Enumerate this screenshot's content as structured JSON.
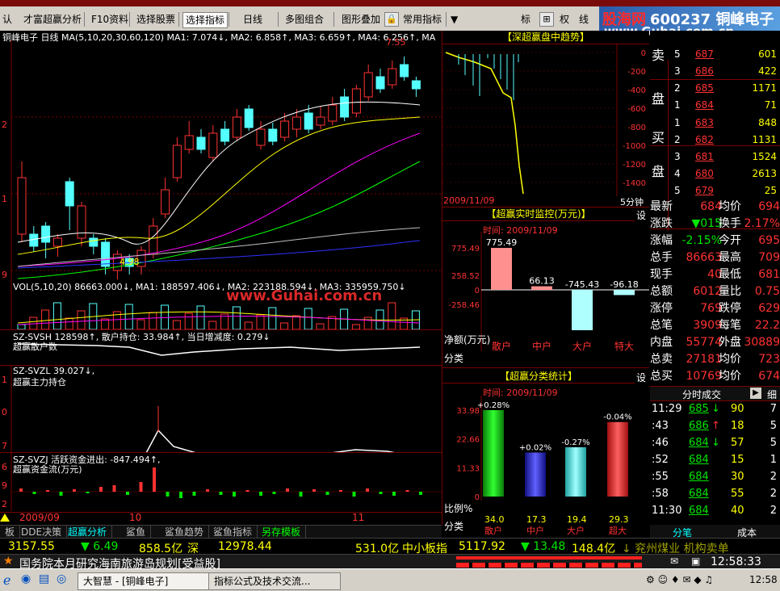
{
  "menu": {
    "toolbar_items": [
      "认",
      "才富超赢分析",
      "F10资料",
      "选择股票",
      "选择指标",
      "日线",
      "多图组合",
      "图形叠加",
      "常用指标",
      "标",
      "权",
      "线"
    ]
  },
  "logo": {
    "line1": "股海网",
    "line2": "600237",
    "line3": "www.Guhai.com.cn",
    "stock_name": "铜峰电子"
  },
  "kline": {
    "header": "铜峰电子 日线  MA(5,10,20,30,60,120)  MA1: 7.074↓, MA2: 6.858↑, MA3: 6.659↑, MA4: 6.256↑, MA",
    "high_label": "7.55",
    "low_label": "4.98",
    "yaxis": [
      "1",
      "2",
      "1",
      "9"
    ],
    "dates": [
      "2009/09",
      "10",
      "11"
    ]
  },
  "vol": {
    "header": "VOL(5,10,20)  86663.000↓, MA1: 188597.406↓, MA2: 223188.594↓, MA3: 335959.750↓",
    "yaxis": [
      "0",
      "0",
      "5",
      "0"
    ]
  },
  "ind1": {
    "header": "SZ-SVSH  128598↑,  散户持仓: 33.984↑,  当日增减度: 0.279↓",
    "sub": "超赢散户数"
  },
  "ind2": {
    "header": "SZ-SVZL  39.027↓,",
    "sub": "超赢主力持仓",
    "yaxis": [
      "1",
      "0",
      "7"
    ]
  },
  "ind3": {
    "header": "SZ-SVZJ  活跃资金进出: -847.494↑,",
    "sub": "超赢资金流(万元)",
    "yaxis": [
      "6",
      "9",
      "2"
    ]
  },
  "watermark": "www.Guhai.com.cn",
  "trend": {
    "title": "【深超赢盘中趋势】",
    "yticks": [
      "0",
      "-200",
      "-400",
      "-600",
      "-800",
      "-1000",
      "-1200",
      "-1400"
    ],
    "date": "2009/11/09",
    "period": "5分钟"
  },
  "monitor": {
    "title": "【超赢实时监控(万元)】",
    "set": "设",
    "time_label": "时间: 2009/11/09",
    "ylabels": [
      "775.49",
      "258.52",
      "0",
      "-258.46"
    ],
    "unit": "净额(万元)",
    "cat_label": "分类",
    "bars": [
      {
        "name": "散户",
        "value": 775.49,
        "label": "775.49"
      },
      {
        "name": "中户",
        "value": 66.13,
        "label": "66.13"
      },
      {
        "name": "大户",
        "value": -745.43,
        "label": "-745.43"
      },
      {
        "name": "特大",
        "value": -96.18,
        "label": "-96.18"
      }
    ]
  },
  "stats": {
    "title": "【超赢分类统计】",
    "set": "设",
    "time_label": "时间: 2009/11/09",
    "ylabels": [
      "33.98",
      "22.66",
      "11.33",
      "0"
    ],
    "unit": "比例%",
    "cat_label": "分类",
    "bars": [
      {
        "name": "散户",
        "value": 34.0,
        "delta": "+0.28%",
        "label": "34.0"
      },
      {
        "name": "中户",
        "value": 17.3,
        "delta": "+0.02%",
        "label": "17.3"
      },
      {
        "name": "大户",
        "value": 19.4,
        "delta": "-0.27%",
        "label": "19.4"
      },
      {
        "name": "超大",
        "value": 29.3,
        "delta": "-0.04%",
        "label": "29.3"
      }
    ]
  },
  "orderbook": {
    "code": "600237",
    "name": "铜峰电子",
    "sell_label": [
      "卖",
      "盘"
    ],
    "buy_label": [
      "买",
      "盘"
    ],
    "sells": [
      {
        "lvl": "5",
        "price": "687",
        "vol": "601"
      },
      {
        "lvl": "3",
        "price": "686",
        "vol": "422"
      },
      {
        "lvl": "2",
        "price": "685",
        "vol": "1171"
      },
      {
        "lvl": "1",
        "price": "684",
        "vol": "71"
      }
    ],
    "buys": [
      {
        "lvl": "1",
        "price": "683",
        "vol": "848"
      },
      {
        "lvl": "2",
        "price": "682",
        "vol": "1131"
      },
      {
        "lvl": "3",
        "price": "681",
        "vol": "1524"
      },
      {
        "lvl": "4",
        "price": "680",
        "vol": "2613"
      },
      {
        "lvl": "5",
        "price": "679",
        "vol": "25"
      }
    ]
  },
  "quote": [
    {
      "k1": "最新",
      "v1": "684",
      "k2": "均价",
      "v2": "694"
    },
    {
      "k1": "涨跌",
      "v1": "▼015",
      "k2": "换手",
      "v2": "2.17%"
    },
    {
      "k1": "涨幅",
      "v1": "-2.15%",
      "k2": "今开",
      "v2": "695"
    },
    {
      "k1": "总手",
      "v1": "86663",
      "k2": "最高",
      "v2": "709"
    },
    {
      "k1": "现手",
      "v1": "40",
      "k2": "最低",
      "v2": "681"
    },
    {
      "k1": "总额",
      "v1": "6012",
      "k2": "量比",
      "v2": "0.75"
    },
    {
      "k1": "涨停",
      "v1": "769",
      "k2": "跌停",
      "v2": "629"
    },
    {
      "k1": "总笔",
      "v1": "3909",
      "k2": "每笔",
      "v2": "22.2"
    },
    {
      "k1": "内盘",
      "v1": "55774",
      "k2": "外盘",
      "v2": "30889"
    },
    {
      "k1": "总卖",
      "v1": "27181",
      "k2": "均价",
      "v2": "723"
    },
    {
      "k1": "总买",
      "v1": "10769",
      "k2": "均价",
      "v2": "674"
    }
  ],
  "ticks": {
    "title": "分时成交",
    "detail": "细",
    "rows": [
      {
        "t": "11:29",
        "p": "685",
        "a": "↓",
        "v": "90",
        "n": "7"
      },
      {
        "t": ":43",
        "p": "686",
        "a": "↑",
        "v": "18",
        "n": "5"
      },
      {
        "t": ":46",
        "p": "684",
        "a": "↓",
        "v": "57",
        "n": "5"
      },
      {
        "t": ":52",
        "p": "684",
        "a": "",
        "v": "15",
        "n": "1"
      },
      {
        "t": ":55",
        "p": "684",
        "a": "",
        "v": "30",
        "n": "2"
      },
      {
        "t": ":58",
        "p": "684",
        "a": "",
        "v": "55",
        "n": "2"
      },
      {
        "t": "11:30",
        "p": "684",
        "a": "",
        "v": "40",
        "n": "2"
      }
    ],
    "tabs": [
      "分笔",
      "成本"
    ]
  },
  "bottom_tabs": [
    "板",
    "DDE决策",
    "超赢分析",
    "鲨鱼",
    "鲨鱼趋势",
    "鲨鱼指标",
    "另存模板"
  ],
  "status": {
    "items": [
      "3157.55",
      "▼ 6.49",
      "858.5亿",
      "深",
      "12978.44",
      "531.0亿",
      "中小板指",
      "5117.92",
      "▼ 13.48",
      "148.4亿",
      "↓ 兖州煤业 机构卖单"
    ],
    "news": "国务院本月研究海南旅游岛规划[受益股]",
    "clock": "12:58:33"
  },
  "taskbar": {
    "win1": "大智慧 - [铜峰电子]",
    "win2": "指标公式及技术交流...",
    "time": "12:58"
  }
}
